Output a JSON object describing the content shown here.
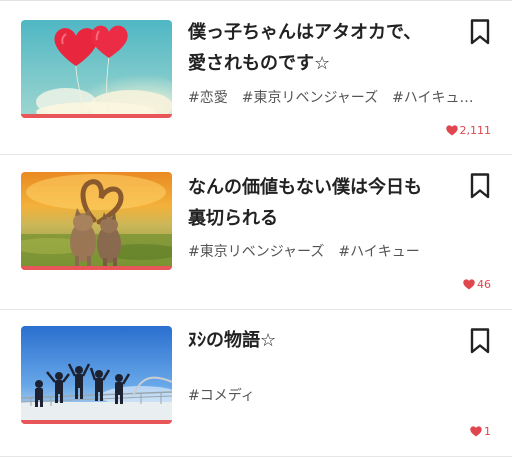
{
  "stories": [
    {
      "title_lines": [
        "僕っ子ちゃんはアタオカで、",
        "愛されものです☆"
      ],
      "tags": [
        "#恋愛",
        "#東京リベンジャーズ",
        "#ハイキュ"
      ],
      "tags_truncated": "…",
      "likes": "2,111",
      "thumbnail": "heart-balloons-image",
      "bookmark_icon": "bookmark-icon",
      "like_icon": "heart-icon"
    },
    {
      "title_lines": [
        "なんの価値もない僕は今日も",
        "裏切られる"
      ],
      "tags": [
        "#東京リベンジャーズ",
        "#ハイキュー"
      ],
      "tags_truncated": "",
      "likes": "46",
      "thumbnail": "cats-heart-tail-image",
      "bookmark_icon": "bookmark-icon",
      "like_icon": "heart-icon"
    },
    {
      "title_lines": [
        "ﾇｼの物語☆",
        ""
      ],
      "tags": [
        "#コメディ"
      ],
      "tags_truncated": "",
      "likes": "1",
      "thumbnail": "students-jumping-image",
      "bookmark_icon": "bookmark-icon",
      "like_icon": "heart-icon"
    }
  ],
  "colors": {
    "accent": "#e8565a",
    "like": "#e0464d",
    "title": "#222222",
    "tag": "#555555",
    "divider": "#e6e6e6"
  }
}
